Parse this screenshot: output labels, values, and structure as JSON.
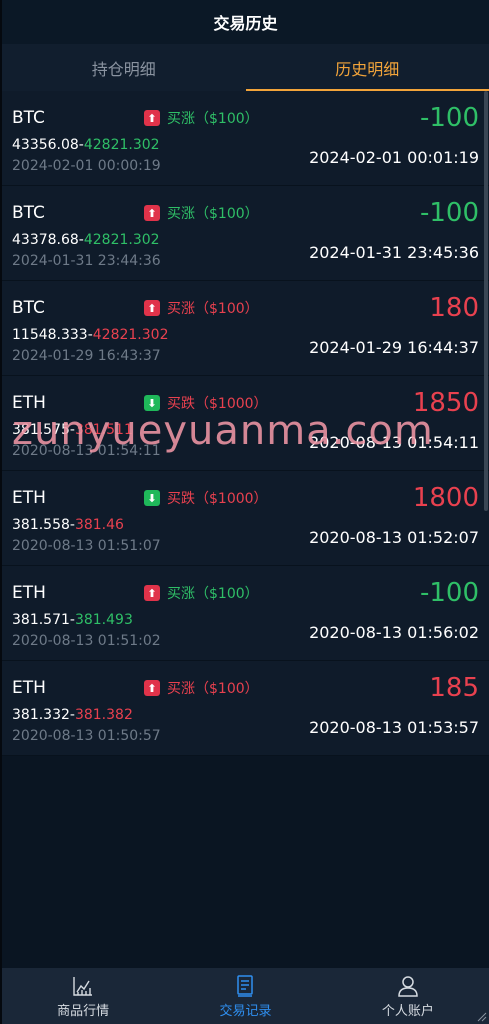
{
  "header": {
    "title": "交易历史"
  },
  "tabs": [
    {
      "label": "持仓明细",
      "active": false
    },
    {
      "label": "历史明细",
      "active": true
    }
  ],
  "trades": [
    {
      "symbol": "BTC",
      "direction": "up",
      "tag": "买涨（$100）",
      "tag_color": "green",
      "open_price": "43356.08-",
      "close_price": "42821.302",
      "close_color": "green",
      "open_time": "2024-02-01 00:00:19",
      "profit": "-100",
      "profit_color": "green",
      "close_time": "2024-02-01 00:01:19"
    },
    {
      "symbol": "BTC",
      "direction": "up",
      "tag": "买涨（$100）",
      "tag_color": "green",
      "open_price": "43378.68-",
      "close_price": "42821.302",
      "close_color": "green",
      "open_time": "2024-01-31 23:44:36",
      "profit": "-100",
      "profit_color": "green",
      "close_time": "2024-01-31 23:45:36"
    },
    {
      "symbol": "BTC",
      "direction": "up",
      "tag": "买涨（$100）",
      "tag_color": "red",
      "open_price": "11548.333-",
      "close_price": "42821.302",
      "close_color": "red",
      "open_time": "2024-01-29 16:43:37",
      "profit": "180",
      "profit_color": "red",
      "close_time": "2024-01-29 16:44:37"
    },
    {
      "symbol": "ETH",
      "direction": "down",
      "tag": "买跌（$1000）",
      "tag_color": "red",
      "open_price": "381.575-",
      "close_price": "381.511",
      "close_color": "red",
      "open_time": "2020-08-13 01:54:11",
      "profit": "1850",
      "profit_color": "red",
      "close_time": "2020-08-13 01:54:11"
    },
    {
      "symbol": "ETH",
      "direction": "down",
      "tag": "买跌（$1000）",
      "tag_color": "red",
      "open_price": "381.558-",
      "close_price": "381.46",
      "close_color": "red",
      "open_time": "2020-08-13 01:51:07",
      "profit": "1800",
      "profit_color": "red",
      "close_time": "2020-08-13 01:52:07"
    },
    {
      "symbol": "ETH",
      "direction": "up",
      "tag": "买涨（$100）",
      "tag_color": "green",
      "open_price": "381.571-",
      "close_price": "381.493",
      "close_color": "green",
      "open_time": "2020-08-13 01:51:02",
      "profit": "-100",
      "profit_color": "green",
      "close_time": "2020-08-13 01:56:02"
    },
    {
      "symbol": "ETH",
      "direction": "up",
      "tag": "买涨（$100）",
      "tag_color": "red",
      "open_price": "381.332-",
      "close_price": "381.382",
      "close_color": "red",
      "open_time": "2020-08-13 01:50:57",
      "profit": "185",
      "profit_color": "red",
      "close_time": "2020-08-13 01:53:57"
    }
  ],
  "watermark": "zunyueyuanma.com",
  "bottom_nav": [
    {
      "label": "商品行情",
      "icon": "chart-icon",
      "active": false
    },
    {
      "label": "交易记录",
      "icon": "records-icon",
      "active": true
    },
    {
      "label": "个人账户",
      "icon": "user-icon",
      "active": false
    }
  ],
  "colors": {
    "background": "#0a1522",
    "row": "#0f1b2a",
    "green": "#2fbf67",
    "red": "#e8414f",
    "accent": "#f2a43a",
    "nav_active": "#2f8ff0"
  }
}
